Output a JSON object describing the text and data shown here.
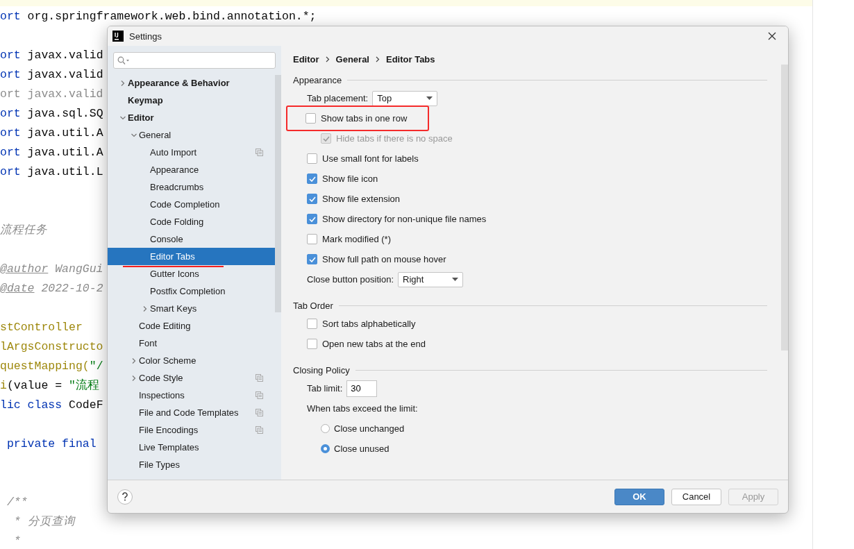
{
  "editor": {
    "lines": [
      {
        "kind": "code",
        "segments": [
          {
            "kind": "keyword",
            "text": "ort"
          },
          {
            "kind": "plain",
            "text": " org.springframework.web.bind.annotation.*;"
          }
        ]
      },
      {
        "kind": "blank"
      },
      {
        "kind": "code",
        "segments": [
          {
            "kind": "keyword",
            "text": "ort"
          },
          {
            "kind": "plain",
            "text": " javax.valid"
          }
        ]
      },
      {
        "kind": "code",
        "segments": [
          {
            "kind": "keyword",
            "text": "ort"
          },
          {
            "kind": "plain",
            "text": " javax.valid"
          }
        ]
      },
      {
        "kind": "code",
        "segments": [
          {
            "kind": "unused",
            "text": "ort javax.valid"
          }
        ]
      },
      {
        "kind": "code",
        "segments": [
          {
            "kind": "keyword",
            "text": "ort"
          },
          {
            "kind": "plain",
            "text": " java.sql.SQ"
          }
        ]
      },
      {
        "kind": "code",
        "segments": [
          {
            "kind": "keyword",
            "text": "ort"
          },
          {
            "kind": "plain",
            "text": " java.util.A"
          }
        ]
      },
      {
        "kind": "code",
        "segments": [
          {
            "kind": "keyword",
            "text": "ort"
          },
          {
            "kind": "plain",
            "text": " java.util.A"
          }
        ]
      },
      {
        "kind": "code",
        "segments": [
          {
            "kind": "keyword",
            "text": "ort"
          },
          {
            "kind": "plain",
            "text": " java.util.L"
          }
        ]
      },
      {
        "kind": "blank"
      },
      {
        "kind": "blank"
      },
      {
        "kind": "code",
        "segments": [
          {
            "kind": "comment",
            "text": "流程任务"
          }
        ]
      },
      {
        "kind": "blank"
      },
      {
        "kind": "code",
        "segments": [
          {
            "kind": "doctag",
            "text": "@author"
          },
          {
            "kind": "comment",
            "text": " WangGui"
          }
        ]
      },
      {
        "kind": "code",
        "segments": [
          {
            "kind": "doctag",
            "text": "@date"
          },
          {
            "kind": "comment",
            "text": " 2022-10-2"
          }
        ]
      },
      {
        "kind": "blank"
      },
      {
        "kind": "code",
        "segments": [
          {
            "kind": "annotation",
            "text": "stController"
          }
        ]
      },
      {
        "kind": "code",
        "segments": [
          {
            "kind": "annotation",
            "text": "lArgsConstructo"
          }
        ]
      },
      {
        "kind": "code",
        "segments": [
          {
            "kind": "annotation",
            "text": "questMapping("
          },
          {
            "kind": "string",
            "text": "\"/"
          }
        ]
      },
      {
        "kind": "code",
        "segments": [
          {
            "kind": "annotation",
            "text": "i"
          },
          {
            "kind": "plain",
            "text": "(value = "
          },
          {
            "kind": "string",
            "text": "\"流程"
          }
        ]
      },
      {
        "kind": "code",
        "segments": [
          {
            "kind": "keyword",
            "text": "lic class"
          },
          {
            "kind": "plain",
            "text": " CodeF"
          }
        ]
      },
      {
        "kind": "blank"
      },
      {
        "kind": "code",
        "segments": [
          {
            "kind": "keyword",
            "text": " private final"
          }
        ]
      },
      {
        "kind": "blank"
      },
      {
        "kind": "blank"
      },
      {
        "kind": "code",
        "segments": [
          {
            "kind": "comment",
            "text": " /**"
          }
        ]
      },
      {
        "kind": "code",
        "segments": [
          {
            "kind": "comment",
            "text": "  * 分页查询"
          }
        ]
      },
      {
        "kind": "code",
        "segments": [
          {
            "kind": "comment",
            "text": "  *"
          }
        ]
      }
    ]
  },
  "dialog": {
    "title": "Settings",
    "tree": [
      {
        "label": "Appearance & Behavior",
        "selected": false,
        "expanded": false
      },
      {
        "label": "Keymap",
        "selected": false
      },
      {
        "label": "Editor",
        "selected": false,
        "expanded": true,
        "children": [
          {
            "label": "General",
            "selected": false,
            "expanded": true,
            "children": [
              {
                "label": "Auto Import",
                "selected": false,
                "project_icon": true
              },
              {
                "label": "Appearance",
                "selected": false
              },
              {
                "label": "Breadcrumbs",
                "selected": false
              },
              {
                "label": "Code Completion",
                "selected": false
              },
              {
                "label": "Code Folding",
                "selected": false
              },
              {
                "label": "Console",
                "selected": false
              },
              {
                "label": "Editor Tabs",
                "selected": true,
                "underlined": true
              },
              {
                "label": "Gutter Icons",
                "selected": false
              },
              {
                "label": "Postfix Completion",
                "selected": false
              },
              {
                "label": "Smart Keys",
                "selected": false,
                "expanded": false
              }
            ]
          },
          {
            "label": "Code Editing",
            "selected": false
          },
          {
            "label": "Font",
            "selected": false
          },
          {
            "label": "Color Scheme",
            "selected": false,
            "expanded": false
          },
          {
            "label": "Code Style",
            "selected": false,
            "expanded": false,
            "project_icon": true
          },
          {
            "label": "Inspections",
            "selected": false,
            "project_icon": true
          },
          {
            "label": "File and Code Templates",
            "selected": false,
            "project_icon": true
          },
          {
            "label": "File Encodings",
            "selected": false,
            "project_icon": true
          },
          {
            "label": "Live Templates",
            "selected": false
          },
          {
            "label": "File Types",
            "selected": false
          }
        ]
      }
    ],
    "breadcrumb": [
      "Editor",
      "General",
      "Editor Tabs"
    ],
    "sections": [
      {
        "title": "Appearance",
        "rows": [
          {
            "kind": "dropdown",
            "label": "Tab placement:",
            "value": "Top"
          },
          {
            "kind": "checkbox",
            "label": "Show tabs in one row",
            "checked": false,
            "disabled": false,
            "highlighted": true
          },
          {
            "kind": "subcheckbox",
            "label": "Hide tabs if there is no space",
            "checked": true,
            "disabled": true
          },
          {
            "kind": "checkbox",
            "label": "Use small font for labels",
            "checked": false,
            "disabled": false
          },
          {
            "kind": "checkbox",
            "label": "Show file icon",
            "checked": true,
            "disabled": false
          },
          {
            "kind": "checkbox",
            "label": "Show file extension",
            "checked": true,
            "disabled": false
          },
          {
            "kind": "checkbox",
            "label": "Show directory for non-unique file names",
            "checked": true,
            "disabled": false
          },
          {
            "kind": "checkbox",
            "label": "Mark modified (*)",
            "checked": false,
            "disabled": false
          },
          {
            "kind": "checkbox",
            "label": "Show full path on mouse hover",
            "checked": true,
            "disabled": false
          },
          {
            "kind": "dropdown",
            "label": "Close button position:",
            "value": "Right"
          }
        ]
      },
      {
        "title": "Tab Order",
        "rows": [
          {
            "kind": "checkbox",
            "label": "Sort tabs alphabetically",
            "checked": false,
            "disabled": false
          },
          {
            "kind": "checkbox",
            "label": "Open new tabs at the end",
            "checked": false,
            "disabled": false
          }
        ]
      },
      {
        "title": "Closing Policy",
        "rows": [
          {
            "kind": "textfield",
            "label": "Tab limit:",
            "value": "30"
          },
          {
            "kind": "label",
            "label": "When tabs exceed the limit:"
          },
          {
            "kind": "radio",
            "label": "Close unchanged",
            "selected": false
          },
          {
            "kind": "radio",
            "label": "Close unused",
            "selected": true
          }
        ]
      }
    ],
    "buttons": [
      {
        "label": "OK",
        "kind": "primary"
      },
      {
        "label": "Cancel",
        "kind": "normal"
      },
      {
        "label": "Apply",
        "kind": "disabled"
      }
    ]
  }
}
